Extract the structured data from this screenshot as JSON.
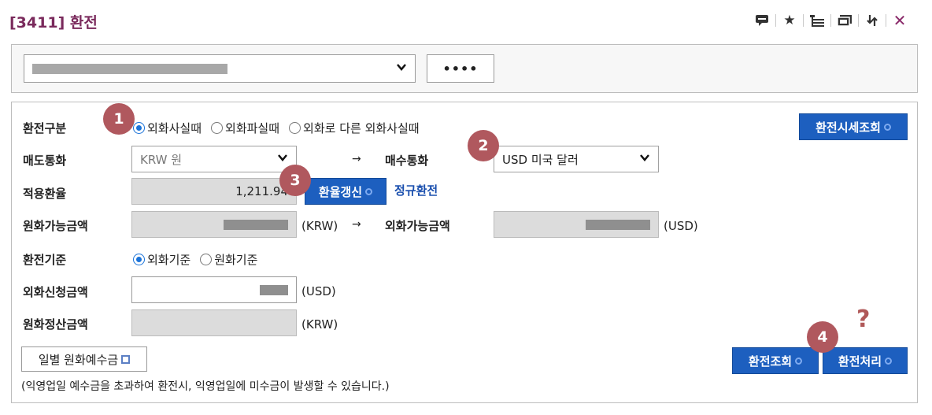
{
  "window": {
    "title": "[3411] 환전"
  },
  "toolbar": {
    "icons": [
      "comment-icon",
      "star-icon",
      "layers-icon",
      "screen-icon",
      "swap-icon",
      "close-icon"
    ],
    "close_symbol": "✕"
  },
  "account": {
    "password_button": "••••"
  },
  "form": {
    "exchange_type": {
      "label": "환전구분",
      "options": [
        "외화사실때",
        "외화파실때",
        "외화로 다른 외화사실때"
      ],
      "selected": "외화사실때"
    },
    "rate_inquiry_button": "환전시세조회",
    "sell_currency": {
      "label": "매도통화",
      "value": "KRW 원"
    },
    "buy_currency": {
      "label": "매수통화",
      "value": "USD 미국 달러"
    },
    "arrow": "→",
    "applied_rate": {
      "label": "적용환율",
      "value": "1,211.94"
    },
    "rate_refresh_button": "환율갱신",
    "regular_exchange_link": "정규환전",
    "krw_available": {
      "label": "원화가능금액",
      "unit": "(KRW)"
    },
    "fx_available": {
      "label": "외화가능금액",
      "unit": "(USD)"
    },
    "exchange_basis": {
      "label": "환전기준",
      "options": [
        "외화기준",
        "원화기준"
      ],
      "selected": "외화기준"
    },
    "fx_request": {
      "label": "외화신청금액",
      "unit": "(USD)"
    },
    "krw_settle": {
      "label": "원화정산금액",
      "unit": "(KRW)"
    },
    "daily_deposit_button": "일별 원화예수금",
    "inquiry_button": "환전조회",
    "process_button": "환전처리",
    "notice": "(익영업일 예수금을 초과하여 환전시, 익영업일에 미수금이 발생할 수 있습니다.)"
  },
  "annotations": {
    "badges": [
      "1",
      "2",
      "3",
      "4"
    ],
    "question": "?"
  },
  "colors": {
    "title": "#7a2a5c",
    "button_blue": "#1d5fbf",
    "badge": "#b0585e",
    "link": "#1a4fae"
  }
}
